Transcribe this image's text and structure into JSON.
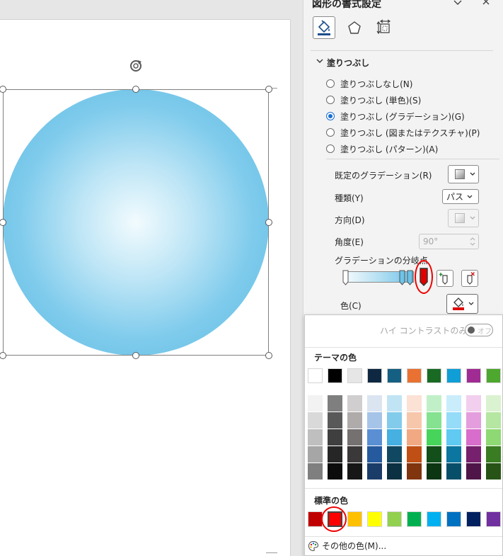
{
  "pane": {
    "title": "図形の書式設定",
    "tabs": [
      "fill-line-icon",
      "effects-icon",
      "size-properties-icon"
    ],
    "section_title": "塗りつぶし"
  },
  "fill_options": [
    {
      "label": "塗りつぶしなし(N)",
      "checked": false
    },
    {
      "label": "塗りつぶし (単色)(S)",
      "checked": false
    },
    {
      "label": "塗りつぶし (グラデーション)(G)",
      "checked": true
    },
    {
      "label": "塗りつぶし (図またはテクスチャ)(P)",
      "checked": false
    },
    {
      "label": "塗りつぶし (パターン)(A)",
      "checked": false
    }
  ],
  "gradient": {
    "preset_label": "既定のグラデーション(R)",
    "type_label": "種類(Y)",
    "type_value": "パス",
    "direction_label": "方向(D)",
    "angle_label": "角度(E)",
    "angle_value": "90°",
    "stops_label": "グラデーションの分岐点",
    "color_label": "色(C)",
    "selected_stop_color": "#e00000"
  },
  "picker": {
    "high_contrast_label": "ハイ コントラストのみ(H)",
    "high_contrast_toggle": "オフ",
    "theme_heading": "テーマの色",
    "theme_top": [
      "#ffffff",
      "#000000",
      "#e7e6e6",
      "#0e2841",
      "#156082",
      "#e97132",
      "#196b24",
      "#0f9ed5",
      "#a02b93",
      "#4ea72e"
    ],
    "theme_shades": [
      [
        "#f2f2f2",
        "#7f7f7f",
        "#d0cece",
        "#dbe5f1",
        "#c1e4f5",
        "#fbe2d5",
        "#c1f0c8",
        "#caedfb",
        "#f2cfee",
        "#daf2d0"
      ],
      [
        "#d9d9d9",
        "#595959",
        "#afabab",
        "#a6c4e8",
        "#83cbeb",
        "#f7c7ac",
        "#84e291",
        "#94dcf8",
        "#e59edd",
        "#b5e6a2"
      ],
      [
        "#bfbfbf",
        "#3f3f3f",
        "#757171",
        "#5a8fd4",
        "#45b0e1",
        "#f1a983",
        "#47d45a",
        "#60caf3",
        "#d86dcb",
        "#8ed973"
      ],
      [
        "#a6a6a6",
        "#262626",
        "#3a3838",
        "#265a9e",
        "#104861",
        "#c04f15",
        "#124f1a",
        "#0b769f",
        "#77206d",
        "#3a7c22"
      ],
      [
        "#7f7f7f",
        "#0c0c0c",
        "#171616",
        "#1a3c69",
        "#0a3041",
        "#80350e",
        "#0c3511",
        "#074f69",
        "#4f1548",
        "#275317"
      ]
    ],
    "standard_heading": "標準の色",
    "standard": [
      "#c00000",
      "#ff0000",
      "#ffc000",
      "#ffff00",
      "#92d050",
      "#00b050",
      "#00b0f0",
      "#0070c0",
      "#002060",
      "#7030a0"
    ],
    "more_colors_label": "その他の色(M)..."
  }
}
